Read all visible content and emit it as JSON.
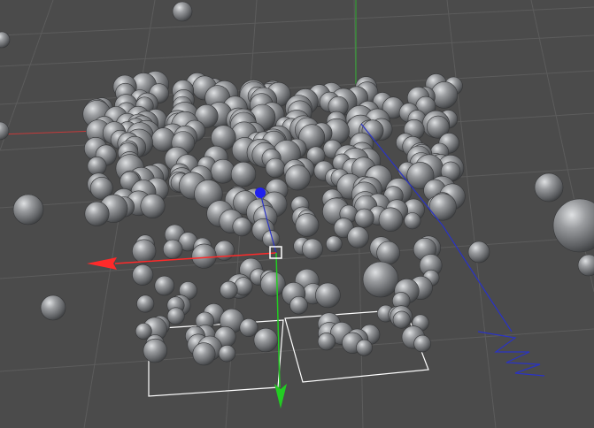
{
  "viewport": {
    "background": "#4b4b4b",
    "grid_color": "#5d5d5d",
    "sphere_color": "#8a8c8e"
  },
  "axes": {
    "x_color": "#ff2a2a",
    "y_color": "#22cc22",
    "z_color": "#2020ee"
  },
  "gizmo": {
    "handle_icon": "move-handle-icon",
    "pivot_color": "#ffffff"
  },
  "spline": {
    "color": "#2233cc"
  },
  "emitter_boxes": {
    "color": "#ffffff",
    "count": 2
  }
}
